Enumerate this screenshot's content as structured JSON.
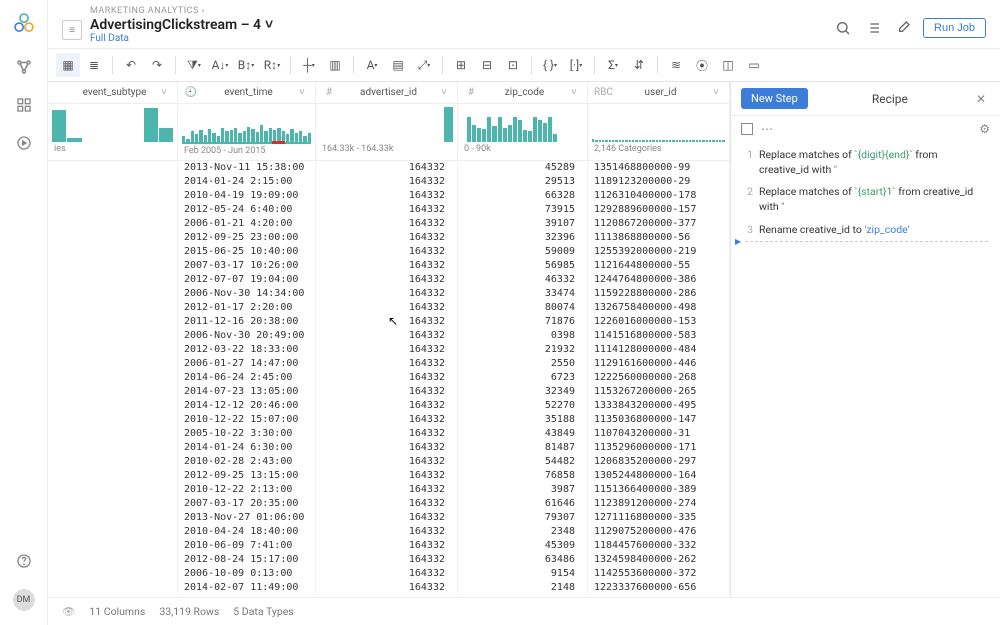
{
  "header": {
    "crumb": "MARKETING ANALYTICS ›",
    "title": "AdvertisingClickstream – 4",
    "title_suffix": "˅",
    "fulldata": "Full Data",
    "run_job": "Run Job"
  },
  "recipe": {
    "new_step": "New Step",
    "title": "Recipe",
    "steps": [
      {
        "num": "1",
        "verb": "Replace matches of ",
        "token": "`{digit}{end}`",
        "tail": " from creative_id with ",
        "quote": "''"
      },
      {
        "num": "2",
        "verb": "Replace matches of ",
        "token": "`{start}1`",
        "tail": " from creative_id with ",
        "quote": "''"
      },
      {
        "num": "3",
        "verb": "Rename",
        "tail": " creative_id to ",
        "token2": "'zip_code'"
      }
    ]
  },
  "columns": [
    {
      "key": "subtype",
      "type": "",
      "name": "event_subtype",
      "axis": [
        "ies",
        ""
      ]
    },
    {
      "key": "time",
      "type": "clock",
      "name": "event_time",
      "axis": [
        "Feb 2005 - Jun 2015",
        ""
      ]
    },
    {
      "key": "adv",
      "type": "#",
      "name": "advertiser_id",
      "axis": [
        "164.33k - 164.33k",
        ""
      ]
    },
    {
      "key": "zip",
      "type": "#",
      "name": "zip_code",
      "axis": [
        "0 - 90k",
        ""
      ]
    },
    {
      "key": "user",
      "type": "RBC",
      "name": "user_id",
      "axis": [
        "2,146 Categories",
        ""
      ]
    }
  ],
  "histograms": {
    "subtype": [
      90,
      10,
      0,
      0,
      0,
      0,
      95,
      40
    ],
    "time": [
      18,
      8,
      30,
      22,
      34,
      20,
      36,
      26,
      18,
      38,
      30,
      34,
      40,
      24,
      30,
      42,
      36,
      28,
      46,
      30,
      38,
      34,
      40,
      30,
      22,
      36,
      24,
      30,
      18,
      26
    ],
    "adv": [
      0,
      0,
      0,
      0,
      0,
      0,
      0,
      0,
      0,
      0,
      0,
      0,
      98
    ],
    "zip": [
      0,
      70,
      48,
      40,
      36,
      70,
      44,
      70,
      38,
      46,
      70,
      60,
      34,
      30,
      70,
      62,
      52,
      70,
      22,
      0,
      0,
      0,
      0,
      0
    ],
    "user": [
      8,
      5,
      5,
      5,
      5,
      5,
      5,
      5,
      5,
      5,
      5,
      5,
      5,
      5,
      5,
      5,
      5,
      5,
      5,
      5,
      5,
      5,
      5,
      5,
      5,
      5,
      5,
      5,
      5,
      5,
      5,
      5,
      5,
      5,
      5,
      5,
      5,
      5,
      5,
      5
    ]
  },
  "rows": [
    [
      "",
      "2013-Nov-11 15:38:00",
      "164332",
      "45289",
      "1351468800000-99"
    ],
    [
      "",
      "2014-01-24 2:15:00",
      "164332",
      "29513",
      "1189123200000-29"
    ],
    [
      "",
      "2010-04-19 19:09:00",
      "164332",
      "66328",
      "1126310400000-178"
    ],
    [
      "",
      "2012-05-24 6:40:00",
      "164332",
      "73915",
      "1292889600000-157"
    ],
    [
      "",
      "2006-01-21 4:20:00",
      "164332",
      "39107",
      "1120867200000-377"
    ],
    [
      "",
      "2012-09-25 23:00:00",
      "164332",
      "32396",
      "1113868800000-56"
    ],
    [
      "",
      "2015-06-25 10:40:00",
      "164332",
      "59009",
      "1255392000000-219"
    ],
    [
      "",
      "2007-03-17 10:26:00",
      "164332",
      "56985",
      "1121644800000-55"
    ],
    [
      "",
      "2012-07-07 19:04:00",
      "164332",
      "46332",
      "1244764800000-386"
    ],
    [
      "",
      "2006-Nov-30 14:34:00",
      "164332",
      "33474",
      "1159228800000-286"
    ],
    [
      "",
      "2012-01-17 2:20:00",
      "164332",
      "80074",
      "1326758400000-498"
    ],
    [
      "",
      "2011-12-16 20:38:00",
      "164332",
      "71876",
      "1226016000000-153"
    ],
    [
      "",
      "2006-Nov-30 20:49:00",
      "164332",
      "0398",
      "1141516800000-583"
    ],
    [
      "",
      "2012-03-22 18:33:00",
      "164332",
      "21932",
      "1114128000000-484"
    ],
    [
      "",
      "2006-01-27 14:47:00",
      "164332",
      "2550",
      "1129161600000-446"
    ],
    [
      "",
      "2014-06-24 2:45:00",
      "164332",
      "6723",
      "1222560000000-268"
    ],
    [
      "",
      "2014-07-23 13:05:00",
      "164332",
      "32349",
      "1153267200000-265"
    ],
    [
      "",
      "2014-12-12 20:46:00",
      "164332",
      "52270",
      "1333843200000-495"
    ],
    [
      "",
      "2010-12-22 15:07:00",
      "164332",
      "35188",
      "1135036800000-147"
    ],
    [
      "",
      "2005-10-22 3:30:00",
      "164332",
      "43849",
      "1107043200000-31"
    ],
    [
      "",
      "2014-01-24 6:30:00",
      "164332",
      "81487",
      "1135296000000-171"
    ],
    [
      "",
      "2010-02-28 2:43:00",
      "164332",
      "54482",
      "1206835200000-297"
    ],
    [
      "",
      "2012-09-25 13:15:00",
      "164332",
      "76858",
      "1305244800000-164"
    ],
    [
      "",
      "2010-12-22 2:13:00",
      "164332",
      "3987",
      "1151366400000-389"
    ],
    [
      "",
      "2007-03-17 20:35:00",
      "164332",
      "61646",
      "1123891200000-274"
    ],
    [
      "",
      "2013-Nov-27 01:06:00",
      "164332",
      "79307",
      "1271116800000-335"
    ],
    [
      "",
      "2010-04-24 18:40:00",
      "164332",
      "2348",
      "1129075200000-476"
    ],
    [
      "",
      "2010-06-09 7:41:00",
      "164332",
      "45309",
      "1184457600000-332"
    ],
    [
      "",
      "2012-08-24 15:17:00",
      "164332",
      "63486",
      "1324598400000-262"
    ],
    [
      "",
      "2006-10-09 0:13:00",
      "164332",
      "9154",
      "1142553600000-372"
    ],
    [
      "",
      "2014-02-07 11:49:00",
      "164332",
      "2148",
      "1223337600000-656"
    ]
  ],
  "status": {
    "cols": "11 Columns",
    "rows": "33,119 Rows",
    "types": "5 Data Types"
  },
  "avatar": "DM"
}
